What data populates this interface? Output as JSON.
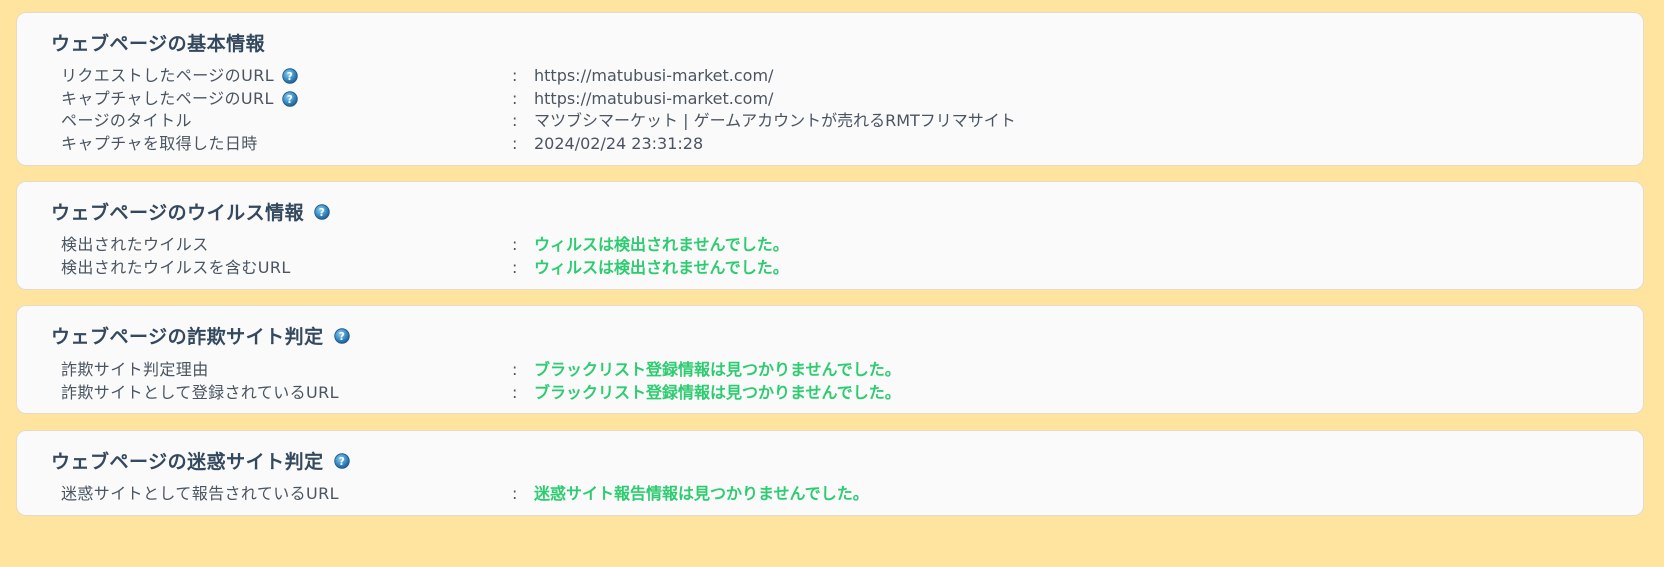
{
  "sections": {
    "basic": {
      "title": "ウェブページの基本情報",
      "rows": [
        {
          "label": "リクエストしたページのURL",
          "value": "https://matubusi-market.com/",
          "help": true
        },
        {
          "label": "キャプチャしたページのURL",
          "value": "https://matubusi-market.com/",
          "help": true
        },
        {
          "label": "ページのタイトル",
          "value": "マツブシマーケット | ゲームアカウントが売れるRMTフリマサイト",
          "help": false
        },
        {
          "label": "キャプチャを取得した日時",
          "value": "2024/02/24 23:31:28",
          "help": false
        }
      ]
    },
    "virus": {
      "title": "ウェブページのウイルス情報",
      "rows": [
        {
          "label": "検出されたウイルス",
          "value": "ウィルスは検出されませんでした。"
        },
        {
          "label": "検出されたウイルスを含むURL",
          "value": "ウィルスは検出されませんでした。"
        }
      ]
    },
    "fraud": {
      "title": "ウェブページの詐欺サイト判定",
      "rows": [
        {
          "label": "詐欺サイト判定理由",
          "value": "ブラックリスト登録情報は見つかりませんでした。"
        },
        {
          "label": "詐欺サイトとして登録されているURL",
          "value": "ブラックリスト登録情報は見つかりませんでした。"
        }
      ]
    },
    "spam": {
      "title": "ウェブページの迷惑サイト判定",
      "rows": [
        {
          "label": "迷惑サイトとして報告されているURL",
          "value": "迷惑サイト報告情報は見つかりませんでした。"
        }
      ]
    }
  },
  "separator": ":",
  "icons": {
    "help": "question-help-icon"
  },
  "colors": {
    "background": "#ffe4a0",
    "ok_text": "#2ecc71",
    "help_icon": "#2f7fb8"
  }
}
